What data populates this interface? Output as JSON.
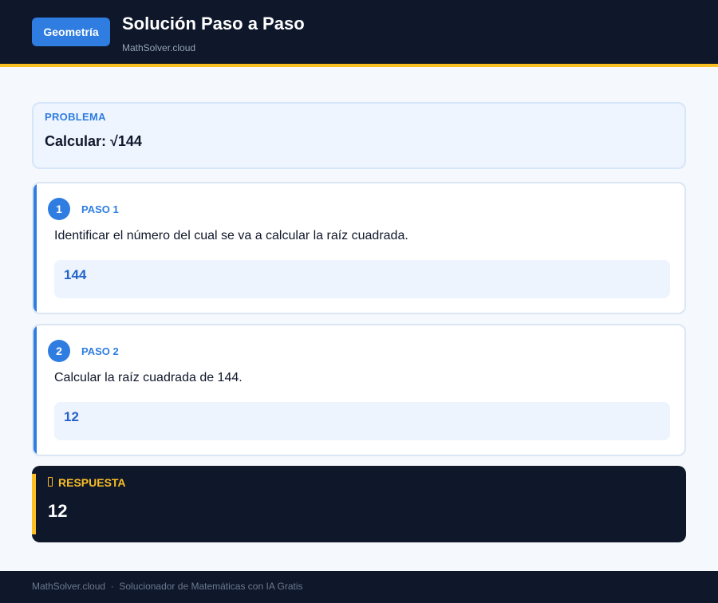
{
  "header": {
    "badge": "Geometría",
    "title": "Solución Paso a Paso",
    "subtitle": "MathSolver.cloud"
  },
  "problem": {
    "label": "PROBLEMA",
    "text": "Calcular: √144"
  },
  "steps": [
    {
      "number": "1",
      "label": "PASO 1",
      "text": "Identificar el número del cual se va a calcular la raíz cuadrada.",
      "result": "144"
    },
    {
      "number": "2",
      "label": "PASO 2",
      "text": "Calcular la raíz cuadrada de 144.",
      "result": "12"
    }
  ],
  "answer": {
    "icon": "lightbulb-icon",
    "label": "RESPUESTA",
    "value": "12"
  },
  "footer": {
    "text": "MathSolver.cloud  ·  Solucionador de Matemáticas con IA Gratis"
  },
  "colors": {
    "accent": "#2f7de1",
    "highlight": "#fbbf24",
    "dark": "#0f172a"
  }
}
